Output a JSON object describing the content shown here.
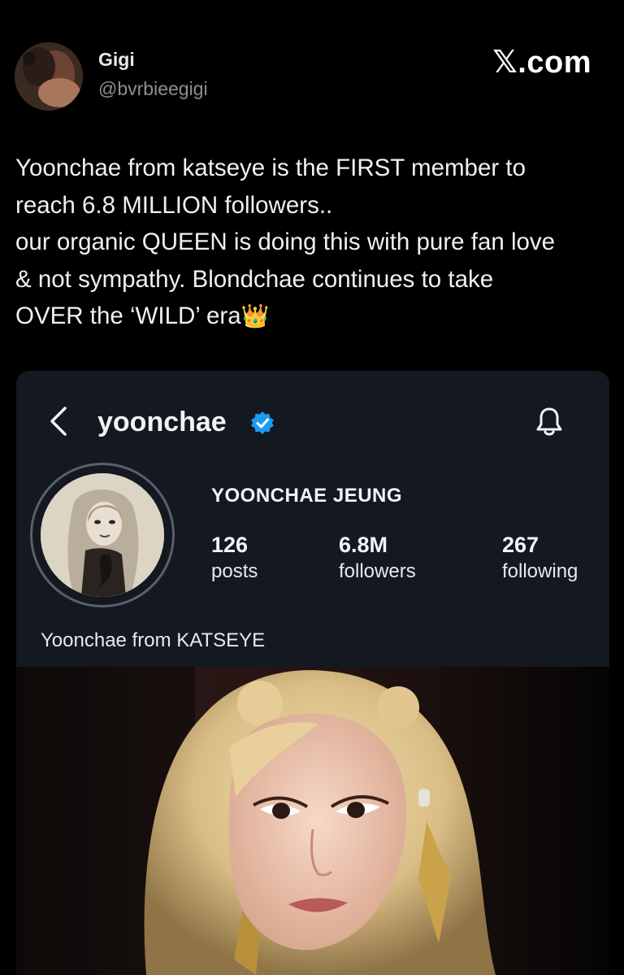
{
  "tweet": {
    "author_name": "Gigi",
    "author_handle": "@bvrbieegigi",
    "site_mark": "𝕏.com",
    "lines": [
      "Yoonchae from katseye is the FIRST member to",
      "reach 6.8 MILLION followers..",
      "our organic QUEEN is doing this with pure fan love",
      "& not sympathy. Blondchae continues to take",
      "OVER the ‘WILD’ era"
    ],
    "emoji": "👑"
  },
  "profile": {
    "username": "yoonchae",
    "full_name": "YOONCHAE JEUNG",
    "stats": [
      {
        "value": "126",
        "label": "posts"
      },
      {
        "value": "6.8M",
        "label": "followers"
      },
      {
        "value": "267",
        "label": "following"
      }
    ],
    "bio": "Yoonchae from KATSEYE"
  },
  "icons": {
    "back": "chevron-left-icon",
    "verified": "verified-badge-icon",
    "bell": "bell-icon"
  },
  "colors": {
    "background": "#000000",
    "card": "#141820",
    "verified": "#1d9bf0",
    "handle": "#8b8f94"
  }
}
